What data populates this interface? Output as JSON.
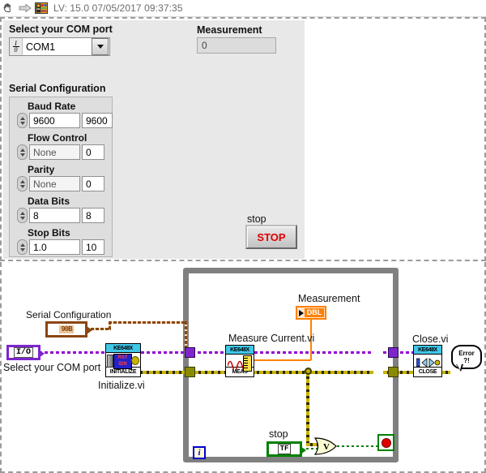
{
  "titlebar": {
    "icons": [
      "hand-cursor-icon",
      "arrow-right-icon",
      "labview-vi-icon"
    ],
    "title": "LV: 15.0 07/05/2017 09:37:35"
  },
  "front_panel": {
    "com_port": {
      "label": "Select your COM port",
      "value": "COM1",
      "glyph_top": "I",
      "glyph_bottom": "0"
    },
    "measurement": {
      "label": "Measurement",
      "value": "0"
    },
    "serial_configuration": {
      "label": "Serial Configuration",
      "rows": [
        {
          "name": "Baud Rate",
          "value": "9600",
          "side": "9600"
        },
        {
          "name": "Flow Control",
          "value": "None",
          "side": "0"
        },
        {
          "name": "Parity",
          "value": "None",
          "side": "0"
        },
        {
          "name": "Data Bits",
          "value": "8",
          "side": "8"
        },
        {
          "name": "Stop Bits",
          "value": "1.0",
          "side": "10"
        }
      ]
    },
    "stop": {
      "label": "stop",
      "button_text": "STOP",
      "button_color": "#e00000"
    }
  },
  "block_diagram": {
    "serial_config_terminal": {
      "label": "Serial Configuration",
      "glyph": "90B"
    },
    "io_terminal": {
      "label": "Select your COM port",
      "glyph": "I/O"
    },
    "initialize_vi": {
      "caption": "Initialize.vi",
      "header": "KE648X",
      "footer": "INITIALIZE",
      "badge_line1": "RST",
      "badge_line2": "IDN"
    },
    "measure_current_vi": {
      "caption": "Measure Current.vi",
      "header": "KE648X",
      "footer": "MEAS"
    },
    "close_vi": {
      "caption": "Close.vi",
      "header": "KE648X",
      "footer": "CLOSE"
    },
    "measurement_indicator": {
      "label": "Measurement",
      "datatype": "DBL"
    },
    "stop_terminal": {
      "label": "stop",
      "glyph": "TF"
    },
    "or_gate": {
      "symbol": "V"
    },
    "iteration_terminal": {
      "glyph": "i"
    },
    "error_handler": {
      "line1": "Error",
      "line2": "?!"
    },
    "colors": {
      "visa_wire": "#9400d3",
      "error_wire": "#c8b400",
      "cluster_wire": "#8b4513",
      "double_wire": "#ff8000",
      "boolean_wire": "#008000",
      "loop_border": "#808080",
      "subvi_header": "#3fc7e8"
    }
  }
}
